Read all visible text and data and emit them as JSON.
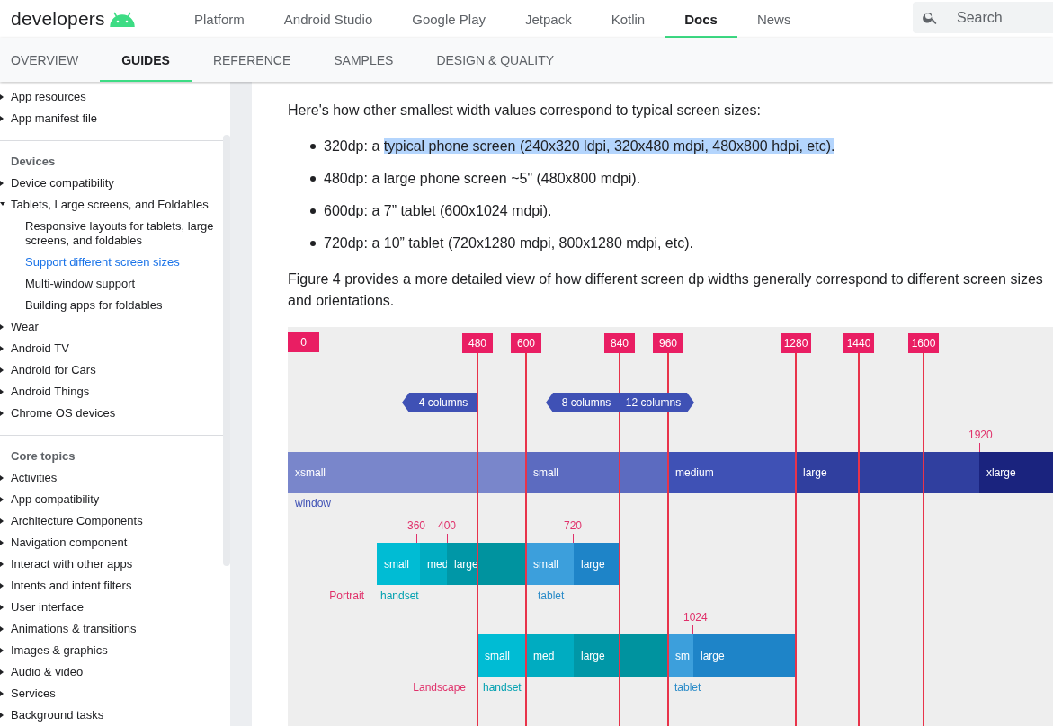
{
  "header": {
    "logo": "developers",
    "nav": [
      {
        "label": "Platform",
        "selected": false
      },
      {
        "label": "Android Studio",
        "selected": false
      },
      {
        "label": "Google Play",
        "selected": false
      },
      {
        "label": "Jetpack",
        "selected": false
      },
      {
        "label": "Kotlin",
        "selected": false
      },
      {
        "label": "Docs",
        "selected": true
      },
      {
        "label": "News",
        "selected": false
      }
    ],
    "search": {
      "placeholder": "Search"
    }
  },
  "subnav": [
    {
      "label": "OVERVIEW",
      "selected": false
    },
    {
      "label": "GUIDES",
      "selected": true
    },
    {
      "label": "REFERENCE",
      "selected": false
    },
    {
      "label": "SAMPLES",
      "selected": false
    },
    {
      "label": "DESIGN & QUALITY",
      "selected": false
    }
  ],
  "sidebar": {
    "sections": [
      {
        "items": [
          {
            "label": "App resources",
            "expanded": false
          },
          {
            "label": "App manifest file",
            "expanded": false
          }
        ]
      },
      {
        "heading": "Devices",
        "items": [
          {
            "label": "Device compatibility",
            "expanded": false
          },
          {
            "label": "Tablets, Large screens, and Foldables",
            "expanded": true,
            "children": [
              {
                "label": "Responsive layouts for tablets, large screens, and foldables",
                "selected": false
              },
              {
                "label": "Support different screen sizes",
                "selected": true
              },
              {
                "label": "Multi-window support",
                "selected": false
              },
              {
                "label": "Building apps for foldables",
                "selected": false
              }
            ]
          },
          {
            "label": "Wear",
            "expanded": false
          },
          {
            "label": "Android TV",
            "expanded": false
          },
          {
            "label": "Android for Cars",
            "expanded": false
          },
          {
            "label": "Android Things",
            "expanded": false
          },
          {
            "label": "Chrome OS devices",
            "expanded": false
          }
        ]
      },
      {
        "heading": "Core topics",
        "items": [
          {
            "label": "Activities",
            "expanded": false
          },
          {
            "label": "App compatibility",
            "expanded": false
          },
          {
            "label": "Architecture Components",
            "expanded": false
          },
          {
            "label": "Navigation component",
            "expanded": false
          },
          {
            "label": "Interact with other apps",
            "expanded": false
          },
          {
            "label": "Intents and intent filters",
            "expanded": false
          },
          {
            "label": "User interface",
            "expanded": false
          },
          {
            "label": "Animations & transitions",
            "expanded": false
          },
          {
            "label": "Images & graphics",
            "expanded": false
          },
          {
            "label": "Audio & video",
            "expanded": false
          },
          {
            "label": "Services",
            "expanded": false
          },
          {
            "label": "Background tasks",
            "expanded": false
          }
        ]
      }
    ]
  },
  "content": {
    "intro": "Here's how other smallest width values correspond to typical screen sizes:",
    "bullets": [
      {
        "text": "320dp: a ",
        "highlighted": "typical phone screen (240x320 ldpi, 320x480 mdpi, 480x800 hdpi, etc)."
      },
      {
        "text": "480dp: a large phone screen ~5\" (480x800 mdpi)."
      },
      {
        "text": "600dp: a 7” tablet (600x1024 mdpi)."
      },
      {
        "text": "720dp: a 10” tablet (720x1280 mdpi, 800x1280 mdpi, etc)."
      }
    ],
    "paragraph": "Figure 4 provides a more detailed view of how different screen dp widths generally correspond to different screen sizes and orientations."
  },
  "figure": {
    "breakpoints": [
      "0",
      "480",
      "600",
      "840",
      "960",
      "1280",
      "1440",
      "1600"
    ],
    "columns": [
      "4 columns",
      "8 columns",
      "12 columns"
    ],
    "window": {
      "label": "window",
      "marker": "1920",
      "segments": [
        "xsmall",
        "small",
        "medium",
        "large",
        "xlarge"
      ]
    },
    "orientations": [
      {
        "label": "Portrait",
        "markers": [
          "360",
          "400",
          "720"
        ],
        "segments": [
          "small",
          "med",
          "large",
          "small",
          "large"
        ],
        "devices": [
          "handset",
          "tablet"
        ]
      },
      {
        "label": "Landscape",
        "markers": [
          "1024"
        ],
        "segments": [
          "small",
          "med",
          "large",
          "sm",
          "large"
        ],
        "devices": [
          "handset",
          "tablet"
        ]
      }
    ]
  }
}
